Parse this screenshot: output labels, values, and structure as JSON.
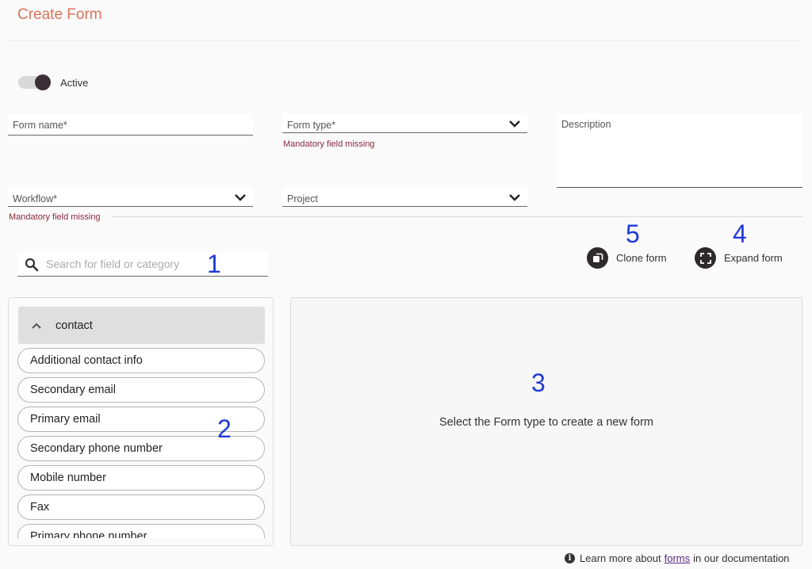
{
  "header": {
    "title": "Create Form"
  },
  "active_toggle": {
    "label": "Active",
    "on": true
  },
  "fields": {
    "form_name": {
      "label": "Form name*",
      "value": ""
    },
    "form_type": {
      "label": "Form type*",
      "value": "",
      "error": "Mandatory field missing"
    },
    "description": {
      "label": "Description",
      "value": ""
    },
    "workflow": {
      "label": "Workflow*",
      "value": "",
      "error": "Mandatory field missing"
    },
    "project": {
      "label": "Project",
      "value": ""
    }
  },
  "search": {
    "placeholder": "Search for field or category",
    "value": ""
  },
  "actions": {
    "clone": {
      "label": "Clone form",
      "icon": "copy-icon"
    },
    "expand": {
      "label": "Expand form",
      "icon": "expand-icon"
    }
  },
  "annotations": {
    "n1": "1",
    "n2": "2",
    "n3": "3",
    "n4": "4",
    "n5": "5"
  },
  "field_panel": {
    "category": "contact",
    "items": [
      "Additional contact info",
      "Secondary email",
      "Primary email",
      "Secondary phone number",
      "Mobile number",
      "Fax",
      "Primary phone number"
    ]
  },
  "canvas": {
    "empty_message": "Select the Form type to create a new form"
  },
  "footer": {
    "prefix": "Learn more about",
    "link": "forms",
    "suffix": "in our documentation",
    "icon": "info-icon"
  },
  "colors": {
    "title": "#d9735a",
    "error": "#8a2a3c",
    "annotation": "#1f3ad8",
    "icon_bg": "#2e2a2c"
  }
}
